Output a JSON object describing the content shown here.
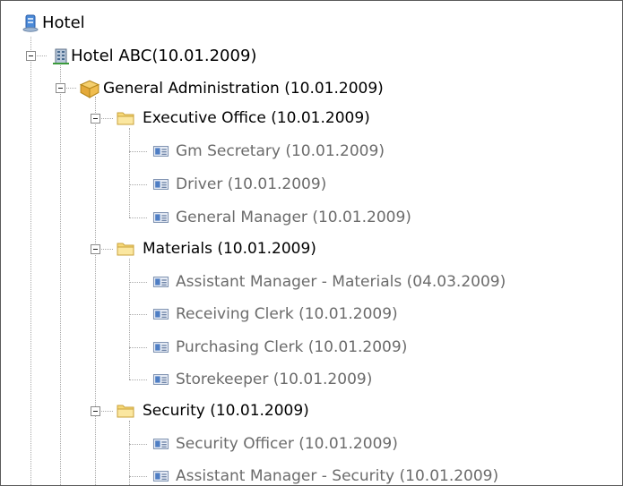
{
  "tree": {
    "root": {
      "label": "Hotel",
      "icon": "server-icon"
    },
    "hotel": {
      "label": "Hotel ABC(10.01.2009)",
      "icon": "building-icon",
      "expanded": true
    },
    "department": {
      "label": "General Administration (10.01.2009)",
      "icon": "package-icon",
      "expanded": true
    },
    "folders": [
      {
        "label": "Executive Office (10.01.2009)",
        "icon": "folder-icon",
        "expanded": true,
        "items": [
          {
            "label": "Gm Secretary (10.01.2009)",
            "icon": "id-card-icon"
          },
          {
            "label": "Driver (10.01.2009)",
            "icon": "id-card-icon"
          },
          {
            "label": "General Manager (10.01.2009)",
            "icon": "id-card-icon"
          }
        ]
      },
      {
        "label": "Materials (10.01.2009)",
        "icon": "folder-icon",
        "expanded": true,
        "items": [
          {
            "label": "Assistant Manager - Materials (04.03.2009)",
            "icon": "id-card-icon"
          },
          {
            "label": "Receiving Clerk (10.01.2009)",
            "icon": "id-card-icon"
          },
          {
            "label": "Purchasing Clerk (10.01.2009)",
            "icon": "id-card-icon"
          },
          {
            "label": "Storekeeper (10.01.2009)",
            "icon": "id-card-icon"
          }
        ]
      },
      {
        "label": "Security (10.01.2009)",
        "icon": "folder-icon",
        "expanded": true,
        "items": [
          {
            "label": "Security Officer (10.01.2009)",
            "icon": "id-card-icon"
          },
          {
            "label": "Assistant Manager - Security (10.01.2009)",
            "icon": "id-card-icon"
          }
        ]
      }
    ]
  }
}
